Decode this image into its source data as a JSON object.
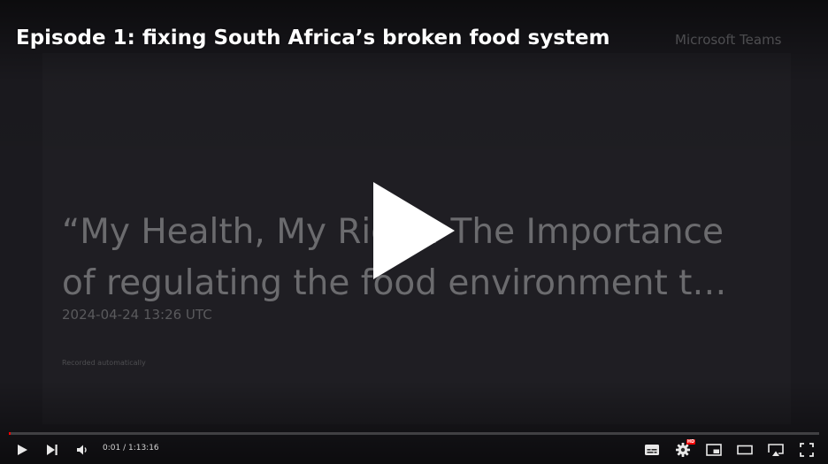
{
  "video": {
    "title": "Episode 1: fixing South Africa’s broken food system"
  },
  "slide": {
    "watermark": "Microsoft Teams",
    "title_line1": "“My Health, My Right: The Importance",
    "title_line2": "of regulating the food environment t…",
    "date": "2024-04-24 13:26 UTC",
    "note": "Recorded automatically"
  },
  "player": {
    "time_display": "0:01 / 1:13:16",
    "progress_fraction": 0.0002,
    "quality_badge": "HD",
    "accent_color": "#ff0000"
  },
  "icons": {
    "big_play": "play-icon",
    "play": "play-icon",
    "next": "next-icon",
    "volume": "volume-icon",
    "subtitles": "subtitles-icon",
    "settings": "gear-icon",
    "miniplayer": "miniplayer-icon",
    "theater": "theater-mode-icon",
    "cast": "cast-icon",
    "fullscreen": "fullscreen-icon"
  }
}
